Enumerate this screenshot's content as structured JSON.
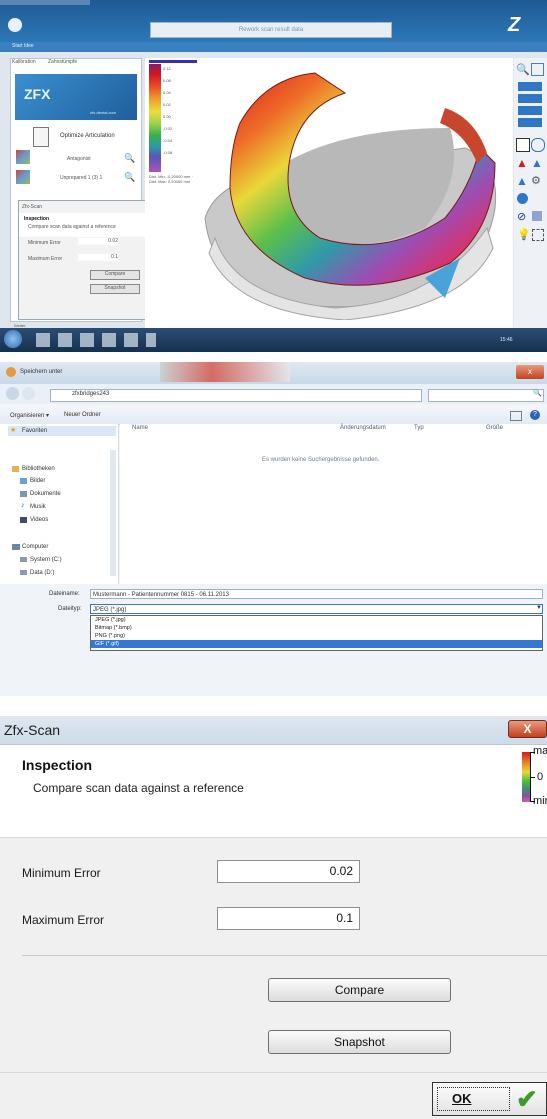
{
  "panel1": {
    "search_placeholder": "Rework scan result data",
    "ribbon_tab": "Start Idee",
    "tab_labels": [
      "Kalibration",
      "Zahnstümpfe"
    ],
    "brand_banner": "ZFX",
    "brand_caption": "zfx-dental.com",
    "optimize_label": "Optimize Articulation",
    "row1_label": "Antagonist",
    "row2_label": "Unprepared 1 (3) 1",
    "mini_dialog": {
      "title": "Zfx-Scan",
      "heading": "Inspection",
      "subtitle": "Compare scan data against a reference",
      "min_label": "Minimum Error",
      "min_value": "0.02",
      "max_label": "Maximum Error",
      "max_value": "0.1",
      "compare": "Compare",
      "snapshot": "Snapshot"
    },
    "status_label": "Weiter",
    "legend_values": [
      "0.12",
      "0.08",
      "0.04",
      "0.02",
      "0.00",
      "-0.02",
      "-0.04",
      "-0.08"
    ],
    "stats_text": "Dist. Min: -0.20000 mm · Dist. Max: 0.20000 mm",
    "clock": "15:46"
  },
  "panel2": {
    "title": "Speichern unter",
    "path": "zfxbridges243",
    "organize": "Organisieren ▾",
    "new_folder": "Neuer Ordner",
    "columns": [
      "Name",
      "Änderungsdatum",
      "Typ",
      "Größe"
    ],
    "empty_message": "Es wurden keine Suchergebnisse gefunden.",
    "nav": [
      {
        "label": "Favoriten",
        "icon": "star-icon"
      },
      {
        "label": "Bibliotheken",
        "icon": "library-icon"
      },
      {
        "label": "Bilder",
        "icon": "pictures-icon"
      },
      {
        "label": "Dokumente",
        "icon": "documents-icon"
      },
      {
        "label": "Musik",
        "icon": "music-icon"
      },
      {
        "label": "Videos",
        "icon": "videos-icon"
      },
      {
        "label": "Computer",
        "icon": "computer-icon"
      },
      {
        "label": "System (C:)",
        "icon": "drive-icon"
      },
      {
        "label": "Data (D:)",
        "icon": "drive-icon"
      }
    ],
    "filename_label": "Dateiname:",
    "filename_value": "Mustermann - Patientennummer 0815 - 06.11.2013",
    "filetype_label": "Dateityp:",
    "filetype_value": "JPEG (*.jpg)",
    "filetype_options": [
      "JPEG (*.jpg)",
      "Bitmap (*.bmp)",
      "PNG (*.png)",
      "GIF (*.gif)"
    ],
    "selected_option_index": 3
  },
  "panel3": {
    "window_title": "Zfx-Scan",
    "close": "X",
    "heading": "Inspection",
    "subtitle": "Compare scan data against a reference",
    "legend_top": "max",
    "legend_mid": "0",
    "legend_bottom": "min",
    "min_label": "Minimum Error",
    "min_value": "0.02",
    "max_label": "Maximum Error",
    "max_value": "0.1",
    "compare": "Compare",
    "snapshot": "Snapshot",
    "ok": "OK",
    "colors": {
      "close_red": "#c2411f",
      "check_green": "#3c9b2a"
    }
  }
}
